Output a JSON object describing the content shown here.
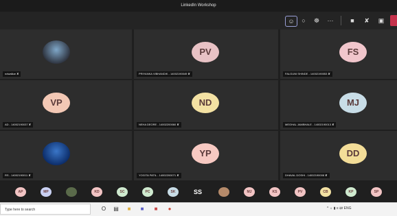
{
  "window": {
    "title": "LinkedIn Workshop"
  },
  "toolbar": {
    "buttons": [
      {
        "name": "people-icon"
      },
      {
        "name": "chat-icon"
      },
      {
        "name": "reactions-icon"
      },
      {
        "name": "more-icon",
        "glyph": "···"
      },
      {
        "name": "camera-icon"
      },
      {
        "name": "mic-off-icon"
      },
      {
        "name": "share-icon"
      }
    ]
  },
  "tiles": [
    {
      "name": "participant-tile-1",
      "type": "photo",
      "label": "ndwalkar",
      "photo_colors": [
        "#7fa7c8",
        "#2b2f3a"
      ]
    },
    {
      "name": "participant-tile-pv",
      "type": "initials",
      "initials": "PV",
      "color": "#e8c2c5",
      "label": "PRIYANKA VIBHANDIK - 14002190049"
    },
    {
      "name": "participant-tile-fs",
      "type": "initials",
      "initials": "FS",
      "color": "#f1c6cc",
      "label": "FALGUNI SHINDE - 14002190053"
    },
    {
      "name": "participant-tile-vp",
      "type": "initials",
      "initials": "VP",
      "color": "#f3c8b5",
      "label": "AD - 14002190037"
    },
    {
      "name": "participant-tile-nd",
      "type": "initials",
      "initials": "ND",
      "color": "#f3e1a3",
      "label": "NEHA DEORE - 14002200060"
    },
    {
      "name": "participant-tile-mj",
      "type": "initials",
      "initials": "MJ",
      "color": "#c8dde7",
      "label": "MEGHAL JAMBHALE - 14002190013"
    },
    {
      "name": "participant-tile-7",
      "type": "photo",
      "label": "RS - 14002190011",
      "photo_colors": [
        "#3a76c8",
        "#0a2a66"
      ]
    },
    {
      "name": "participant-tile-yp",
      "type": "initials",
      "initials": "YP",
      "color": "#f7c9c2",
      "label": "YOGITA PATIL - 14002200071"
    },
    {
      "name": "participant-tile-dd",
      "type": "initials",
      "initials": "DD",
      "color": "#f3dd98",
      "label": "DHAVAL DOSHI - 14002190008"
    }
  ],
  "strip": [
    {
      "t": "av",
      "text": "AP",
      "color": "#f2c4c4"
    },
    {
      "t": "av",
      "text": "MP",
      "color": "#c9d0f2"
    },
    {
      "t": "av",
      "text": "",
      "color": "#5a6a4a"
    },
    {
      "t": "av",
      "text": "KD",
      "color": "#f2c4c4"
    },
    {
      "t": "av",
      "text": "SC",
      "color": "#cfeacf"
    },
    {
      "t": "av",
      "text": "PC",
      "color": "#cfeacf"
    },
    {
      "t": "av",
      "text": "SK",
      "color": "#c8dde7"
    },
    {
      "t": "txt",
      "text": "SS"
    },
    {
      "t": "av",
      "text": "",
      "color": "#b58a6a"
    },
    {
      "t": "av",
      "text": "MJ",
      "color": "#f2c4c4"
    },
    {
      "t": "av",
      "text": "KS",
      "color": "#f2c4c4"
    },
    {
      "t": "av",
      "text": "PV",
      "color": "#f2c4c4"
    },
    {
      "t": "av",
      "text": "CB",
      "color": "#f3e1a3"
    },
    {
      "t": "av",
      "text": "KP",
      "color": "#cfeacf"
    },
    {
      "t": "av",
      "text": "SP",
      "color": "#f2c4c4"
    }
  ],
  "taskbar": {
    "search_placeholder": "Type here to search",
    "icons": [
      {
        "name": "start-icon",
        "glyph": "O"
      },
      {
        "name": "task-view-icon",
        "glyph": "▤"
      },
      {
        "name": "file-explorer-icon",
        "glyph": "■",
        "color": "#e0b040"
      },
      {
        "name": "teams-icon",
        "glyph": "■",
        "color": "#5b5fc7"
      },
      {
        "name": "store-icon",
        "glyph": "■",
        "color": "#c84848"
      },
      {
        "name": "chrome-icon",
        "glyph": "●",
        "color": "#d04a3a"
      }
    ],
    "tray_text": "^ ☼ ▮ ≡ ऴा ENG"
  }
}
